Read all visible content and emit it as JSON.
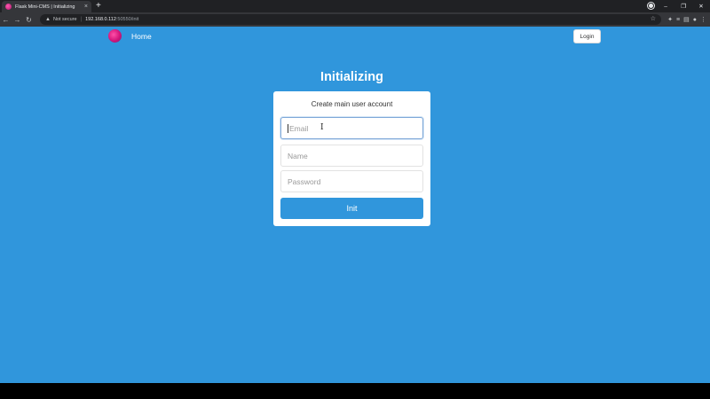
{
  "browser": {
    "tab_title": "Flask Mini-CMS | Initializing",
    "tab_close": "×",
    "new_tab": "+",
    "back": "←",
    "forward": "→",
    "reload": "↻",
    "security_label": "Not secure",
    "url_host": "192.168.0.112",
    "url_path": ":50550/init",
    "window_controls": [
      "–",
      "❐",
      "✕"
    ]
  },
  "navbar": {
    "home_label": "Home",
    "login_label": "Login"
  },
  "main": {
    "title": "Initializing",
    "card": {
      "heading": "Create main user account",
      "email_placeholder": "Email",
      "name_placeholder": "Name",
      "password_placeholder": "Password",
      "submit_label": "Init"
    }
  },
  "colors": {
    "page_background": "#3096dc",
    "button_primary": "#3096dc",
    "browser_dark": "#202124"
  }
}
